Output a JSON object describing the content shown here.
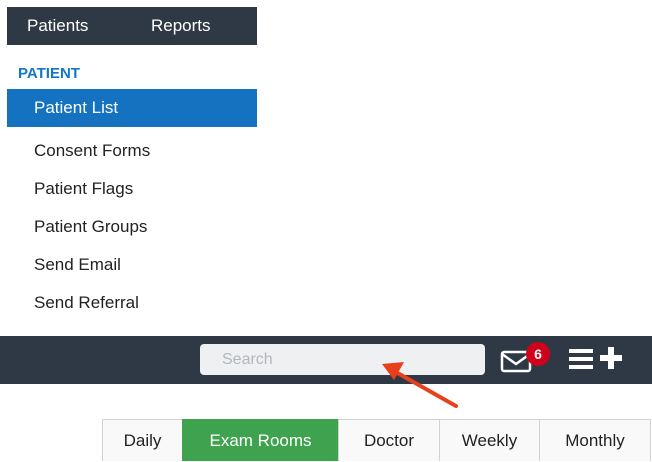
{
  "nav": {
    "patients": "Patients",
    "reports": "Reports"
  },
  "menu": {
    "header": "PATIENT",
    "items": [
      {
        "label": "Patient List",
        "active": true
      },
      {
        "label": "Consent Forms"
      },
      {
        "label": "Patient Flags"
      },
      {
        "label": "Patient Groups"
      },
      {
        "label": "Send Email"
      },
      {
        "label": "Send Referral"
      }
    ]
  },
  "toolbar": {
    "search_placeholder": "Search",
    "mail_badge": "6",
    "icons": [
      "mail-icon",
      "hamburger-menu-icon",
      "plus-icon"
    ]
  },
  "tabs": [
    {
      "label": "Daily"
    },
    {
      "label": "Exam Rooms",
      "active": true
    },
    {
      "label": "Doctor"
    },
    {
      "label": "Weekly"
    },
    {
      "label": "Monthly"
    }
  ],
  "colors": {
    "nav_bg": "#2f3945",
    "menu_header": "#1377c9",
    "menu_active": "#1572c0",
    "tab_active": "#3fa24f",
    "badge": "#d0021b",
    "arrow": "#e8401c"
  }
}
